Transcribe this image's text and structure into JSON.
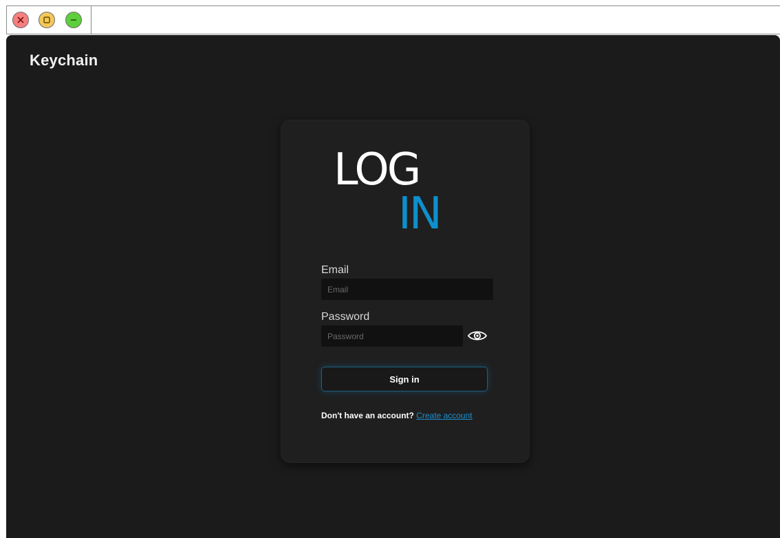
{
  "window": {
    "controls": [
      "close-icon",
      "maximize-icon",
      "minimize-icon"
    ]
  },
  "app": {
    "title": "Keychain"
  },
  "login": {
    "logo_top": "LOG",
    "logo_bottom": "IN",
    "email_label": "Email",
    "email_placeholder": "Email",
    "email_value": "",
    "password_label": "Password",
    "password_placeholder": "Password",
    "password_value": "",
    "show_password_icon": "eye-icon",
    "signin_label": "Sign in",
    "no_account_text": "Don't have an account?",
    "create_account_label": "Create account"
  },
  "colors": {
    "background": "#1b1b1b",
    "card": "#1f1f1f",
    "input": "#111111",
    "accent": "#0f8fcc",
    "text": "#ffffff"
  }
}
